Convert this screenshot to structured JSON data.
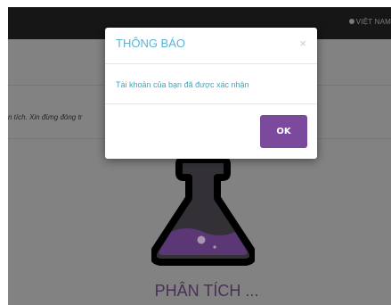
{
  "header": {
    "language_label": "VIỆT NAM"
  },
  "page": {
    "status_text": "n tích. Xin đừng đóng tr",
    "analysis_label": "PHÂN TÍCH ..."
  },
  "dialog": {
    "title": "THÔNG BÁO",
    "close_symbol": "×",
    "message": "Tài khoản của bạn đã được xác nhận",
    "ok_label": "OK"
  },
  "icons": {
    "language": "globe-icon",
    "close": "close-icon",
    "analysis": "flask-icon"
  },
  "colors": {
    "accent_purple": "#7b4a9c",
    "title_blue": "#57b5d6",
    "message_blue": "#36a8c9",
    "topbar": "#2b2b2b"
  }
}
